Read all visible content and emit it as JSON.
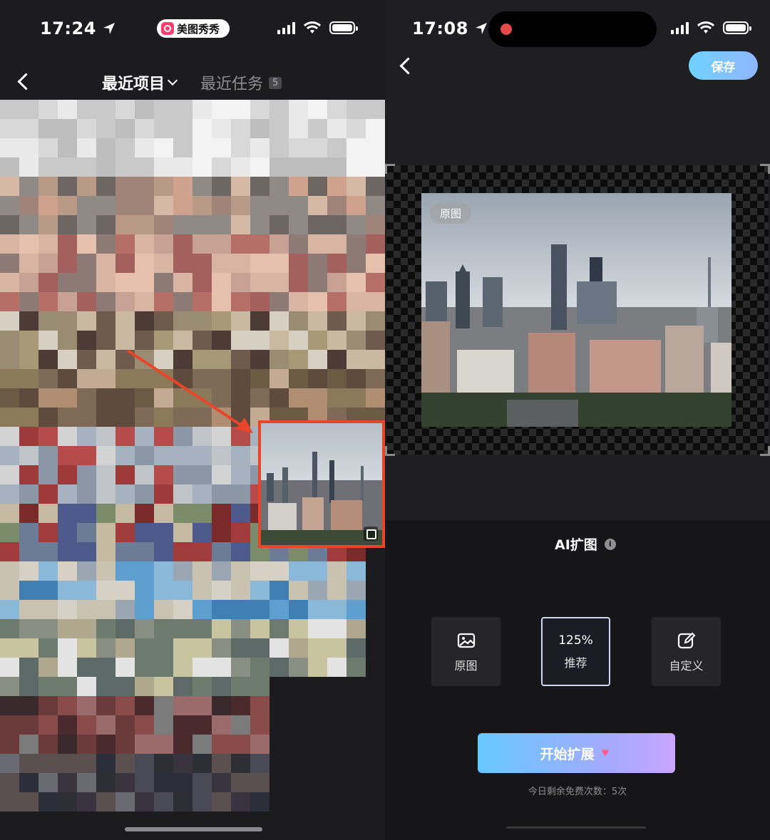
{
  "left": {
    "status": {
      "time": "17:24",
      "app_name": "美图秀秀"
    },
    "tabs": {
      "active": "最近项目",
      "other": "最近任务",
      "other_count": "5"
    }
  },
  "right": {
    "status": {
      "time": "17:08"
    },
    "save_label": "保存",
    "original_tag": "原图",
    "ai_title": "AI扩图",
    "info_glyph": "i",
    "options": [
      {
        "label": "原图",
        "icon": "image-icon"
      },
      {
        "pct": "125%",
        "label": "推荐"
      },
      {
        "label": "自定义",
        "icon": "edit-icon"
      }
    ],
    "start_label": "开始扩展",
    "remaining": "今日剩余免费次数：5次"
  },
  "colors": {
    "highlight": "#e8452a",
    "accent": "#6fd2ff",
    "record": "#e24b46"
  }
}
